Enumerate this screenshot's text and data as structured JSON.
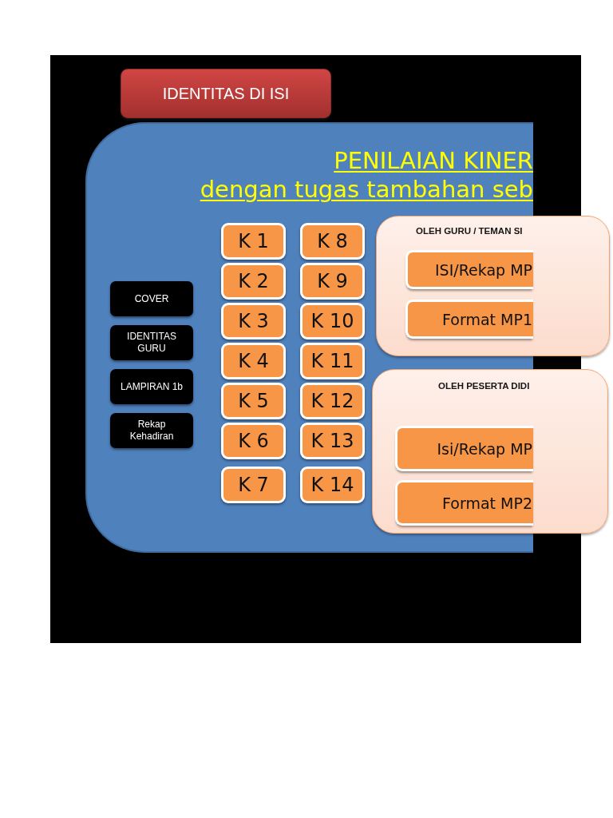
{
  "header_button": {
    "label": "IDENTITAS DI ISI"
  },
  "main_panel": {
    "title": "PENILAIAN KINER",
    "subtitle": "dengan tugas tambahan seb",
    "nav_buttons": [
      {
        "label": "COVER"
      },
      {
        "label": "IDENTITAS GURU"
      },
      {
        "label": "LAMPIRAN 1b"
      },
      {
        "label": "Rekap Kehadiran"
      }
    ],
    "k_columns": [
      [
        "K 1",
        "K 2",
        "K 3",
        "K 4",
        "K 5",
        "K 6",
        "K 7"
      ],
      [
        "K 8",
        "K 9",
        "K 10",
        "K 11",
        "K 12",
        "K 13",
        "K 14"
      ]
    ]
  },
  "sections": [
    {
      "heading": "OLEH GURU / TEMAN SI",
      "buttons": [
        "ISI/Rekap MP",
        "Format MP1"
      ]
    },
    {
      "heading": "OLEH PESERTA DIDI",
      "buttons": [
        "Isi/Rekap MP",
        "Format MP2"
      ]
    }
  ]
}
